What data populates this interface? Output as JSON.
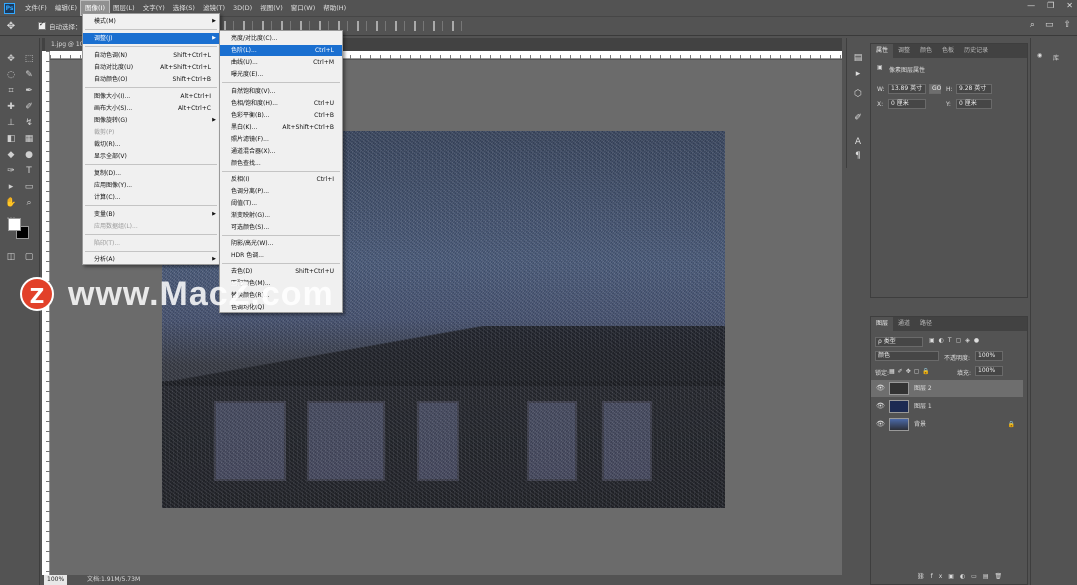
{
  "menubar": {
    "items": [
      "文件(F)",
      "编辑(E)",
      "图像(I)",
      "图层(L)",
      "文字(Y)",
      "选择(S)",
      "滤镜(T)",
      "3D(D)",
      "视图(V)",
      "窗口(W)",
      "帮助(H)"
    ],
    "logo": "Ps"
  },
  "options": {
    "auto_select_label": "自动选择："
  },
  "document": {
    "tab_title": "1.jpg @ 10"
  },
  "status": {
    "zoom": "100%",
    "doc_size": "文档:1.91M/5.73M"
  },
  "image_menu": {
    "items": [
      "模式(M)",
      "调整(J)",
      "自动色调(N)",
      "自动对比度(U)",
      "自动颜色(O)",
      "图像大小(I)...",
      "画布大小(S)...",
      "图像旋转(G)",
      "裁剪(P)",
      "裁切(R)...",
      "显示全部(V)",
      "复制(D)...",
      "应用图像(Y)...",
      "计算(C)...",
      "变量(B)",
      "应用数据组(L)...",
      "陷印(T)...",
      "分析(A)"
    ],
    "shortcuts": {
      "auto_tone": "Shift+Ctrl+L",
      "auto_contrast": "Alt+Shift+Ctrl+L",
      "auto_color": "Shift+Ctrl+B",
      "image_size": "Alt+Ctrl+I",
      "canvas_size": "Alt+Ctrl+C"
    }
  },
  "adjust_menu": {
    "items": [
      "亮度/对比度(C)...",
      "色阶(L)...",
      "曲线(U)...",
      "曝光度(E)...",
      "自然饱和度(V)...",
      "色相/饱和度(H)...",
      "色彩平衡(B)...",
      "黑白(K)...",
      "照片滤镜(F)...",
      "通道混合器(X)...",
      "颜色查找...",
      "反相(I)",
      "色调分离(P)...",
      "阈值(T)...",
      "渐变映射(G)...",
      "可选颜色(S)...",
      "阴影/高光(W)...",
      "HDR 色调...",
      "去色(D)",
      "匹配颜色(M)...",
      "替换颜色(R)...",
      "色调均化(Q)"
    ],
    "shortcuts": {
      "levels": "Ctrl+L",
      "curves": "Ctrl+M",
      "hue_sat": "Ctrl+U",
      "color_balance": "Ctrl+B",
      "bw": "Alt+Shift+Ctrl+B",
      "invert": "Ctrl+I",
      "desaturate": "Shift+Ctrl+U"
    }
  },
  "properties_panel": {
    "tabs": [
      "属性",
      "调整",
      "颜色",
      "色板",
      "历史记录"
    ],
    "title": "像素图层属性",
    "w_label": "W:",
    "w_value": "13.89 英寸",
    "h_label": "H:",
    "h_value": "9.28 英寸",
    "x_label": "X:",
    "x_value": "0 厘米",
    "y_label": "Y:",
    "y_value": "0 厘米",
    "link_label": "GO"
  },
  "layers_panel": {
    "tabs": [
      "图层",
      "通道",
      "路径"
    ],
    "kind": "ρ 类型",
    "blend_mode": "颜色",
    "opacity_label": "不透明度:",
    "opacity_value": "100%",
    "lock_label": "锁定:",
    "fill_label": "填充:",
    "fill_value": "100%",
    "layers": [
      "图层 2",
      "图层 1",
      "背景"
    ]
  },
  "library": {
    "label": "库"
  },
  "watermark": {
    "logo": "Z",
    "text": "www.MacZ.com"
  }
}
